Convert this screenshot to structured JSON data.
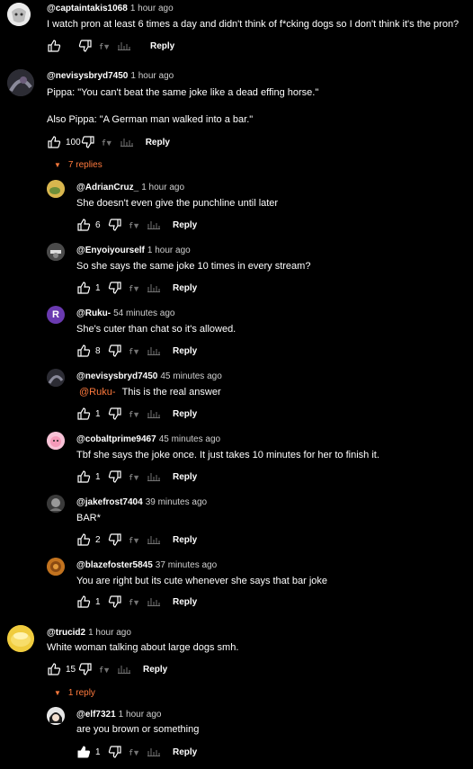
{
  "comments": [
    {
      "user": "@captaintakis1068",
      "time": "1 hour ago",
      "text": "I watch pron at least 6 times a day and didn't think of f*cking dogs so I don't think it's the pron?",
      "likes": "",
      "reply": "Reply"
    },
    {
      "user": "@nevisysbryd7450",
      "time": "1 hour ago",
      "text": "Pippa: \"You can't beat the same joke like a dead effing horse.\"\n\nAlso Pippa: \"A German man walked into a bar.\"",
      "likes": "100",
      "reply": "Reply",
      "replies_toggle": "7 replies"
    },
    {
      "user": "@trucid2",
      "time": "1 hour ago",
      "text": "White woman talking about large dogs smh.",
      "likes": "15",
      "reply": "Reply",
      "replies_toggle": "1 reply"
    }
  ],
  "replies": [
    {
      "user": "@AdrianCruz_",
      "time": "1 hour ago",
      "text": "She doesn't even give the punchline until later",
      "likes": "6",
      "reply": "Reply"
    },
    {
      "user": "@Enyoiyourself",
      "time": "1 hour ago",
      "text": "So she says the same joke 10 times in every stream?",
      "likes": "1",
      "reply": "Reply"
    },
    {
      "user": "@Ruku-",
      "time": "54 minutes ago",
      "text": "She's cuter than chat so it's allowed.",
      "likes": "8",
      "reply": "Reply",
      "avatar_letter": "R"
    },
    {
      "user": "@nevisysbryd7450",
      "time": "45 minutes ago",
      "mention": "@Ruku-",
      "text": "This is the real answer",
      "likes": "1",
      "reply": "Reply"
    },
    {
      "user": "@cobaltprime9467",
      "time": "45 minutes ago",
      "text": "Tbf she says the joke once. It just takes 10 minutes for her to finish it.",
      "likes": "1",
      "reply": "Reply"
    },
    {
      "user": "@jakefrost7404",
      "time": "39 minutes ago",
      "text": "BAR*",
      "likes": "2",
      "reply": "Reply"
    },
    {
      "user": "@blazefoster5845",
      "time": "37 minutes ago",
      "text": "You are right but its cute whenever she says that bar joke",
      "likes": "1",
      "reply": "Reply"
    },
    {
      "user": "@elf7321",
      "time": "1 hour ago",
      "text": "are you brown or something",
      "likes": "1",
      "reply": "Reply"
    }
  ],
  "icons": {
    "like": "thumbs-up-icon",
    "dislike": "thumbs-down-icon",
    "pippa": "pippa-logo-icon",
    "bars": "audio-bars-icon",
    "caret": "caret-down-icon"
  },
  "colors": {
    "background": "#000000",
    "accent": "#ff7a3d",
    "text": "#ffffff",
    "muted": "#d0d0d0"
  }
}
